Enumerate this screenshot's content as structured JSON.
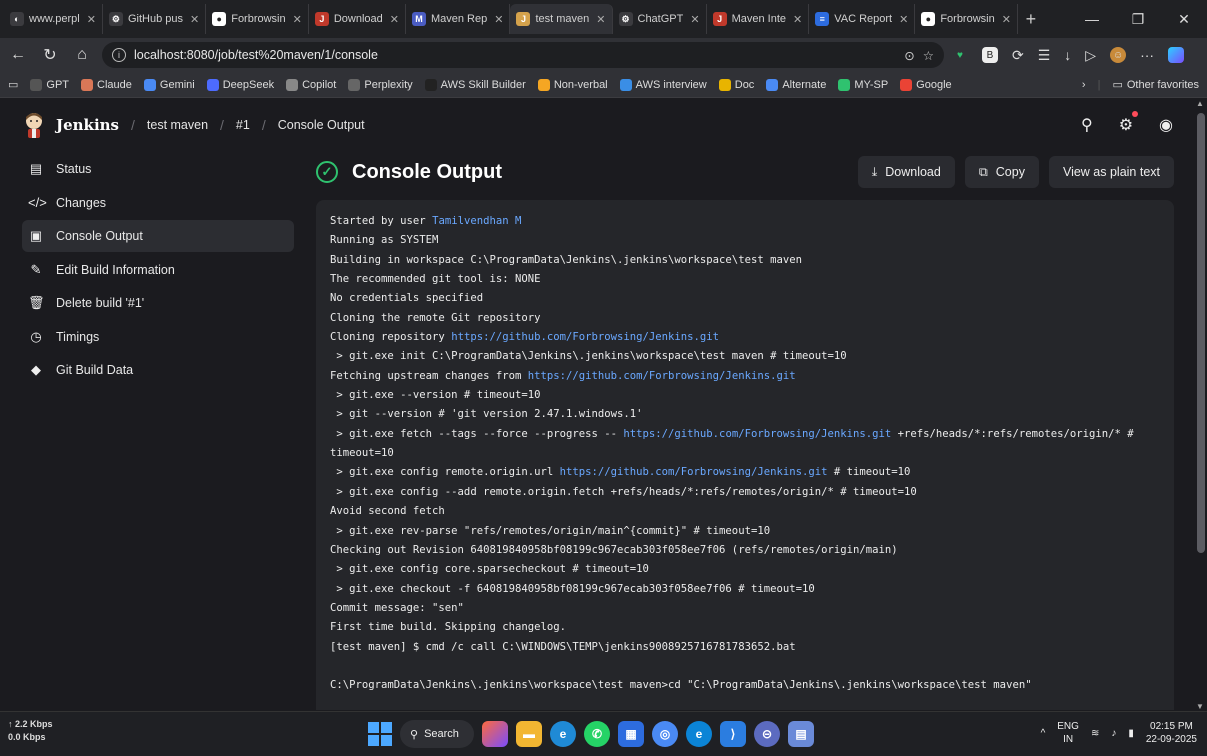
{
  "browser": {
    "tabs": [
      {
        "label": "www.perpl",
        "color": "#3b3b3f",
        "glyph": "◐"
      },
      {
        "label": "GitHub pus",
        "color": "#3b3b3f",
        "glyph": "⚙"
      },
      {
        "label": "Forbrowsin",
        "color": "#ffffff",
        "glyph": "●"
      },
      {
        "label": "Download",
        "color": "#c0392b",
        "glyph": "J"
      },
      {
        "label": "Maven Rep",
        "color": "#4a5cc2",
        "glyph": "M"
      },
      {
        "label": "test maven",
        "color": "#d4a24c",
        "glyph": "J",
        "active": true
      },
      {
        "label": "ChatGPT",
        "color": "#3b3b3f",
        "glyph": "⚙"
      },
      {
        "label": "Maven Inte",
        "color": "#c0392b",
        "glyph": "J"
      },
      {
        "label": "VAC Report",
        "color": "#2d6cdf",
        "glyph": "≡"
      },
      {
        "label": "Forbrowsin",
        "color": "#ffffff",
        "glyph": "●"
      }
    ],
    "new_tab": "+",
    "url": "localhost:8080/job/test%20maven/1/console",
    "favorites": [
      {
        "label": "GPT",
        "color": "#555"
      },
      {
        "label": "Claude",
        "color": "#d97757"
      },
      {
        "label": "Gemini",
        "color": "#4a8af4"
      },
      {
        "label": "DeepSeek",
        "color": "#4d6bfe"
      },
      {
        "label": "Copilot",
        "color": "#888"
      },
      {
        "label": "Perplexity",
        "color": "#666"
      },
      {
        "label": "AWS Skill Builder",
        "color": "#222"
      },
      {
        "label": "Non-verbal",
        "color": "#f5a623"
      },
      {
        "label": "AWS interview",
        "color": "#3a8ee6"
      },
      {
        "label": "Doc",
        "color": "#e8b400"
      },
      {
        "label": "Alternate",
        "color": "#4a8af4"
      },
      {
        "label": "MY-SP",
        "color": "#2fc26f"
      },
      {
        "label": "Google",
        "color": "#ea4335"
      }
    ],
    "other_favorites": "Other favorites"
  },
  "jenkins": {
    "brand": "Jenkins",
    "breadcrumbs": [
      "test maven",
      "#1",
      "Console Output"
    ],
    "sidebar": [
      {
        "label": "Status",
        "icon": "▤"
      },
      {
        "label": "Changes",
        "icon": "</>"
      },
      {
        "label": "Console Output",
        "icon": "▣",
        "active": true
      },
      {
        "label": "Edit Build Information",
        "icon": "✎"
      },
      {
        "label": "Delete build '#1'",
        "icon": "🗑"
      },
      {
        "label": "Timings",
        "icon": "◷"
      },
      {
        "label": "Git Build Data",
        "icon": "◆"
      }
    ],
    "page_title": "Console Output",
    "buttons": {
      "download": "Download",
      "copy": "Copy",
      "plain": "View as plain text"
    },
    "console_lines": [
      {
        "t": "Started by user ",
        "link": "Tamilvendhan M",
        "after": ""
      },
      {
        "t": "Running as SYSTEM"
      },
      {
        "t": "Building in workspace C:\\ProgramData\\Jenkins\\.jenkins\\workspace\\test maven"
      },
      {
        "t": "The recommended git tool is: NONE"
      },
      {
        "t": "No credentials specified"
      },
      {
        "t": "Cloning the remote Git repository"
      },
      {
        "t": "Cloning repository ",
        "link": "https://github.com/Forbrowsing/Jenkins.git",
        "after": ""
      },
      {
        "t": " > git.exe init C:\\ProgramData\\Jenkins\\.jenkins\\workspace\\test maven # timeout=10"
      },
      {
        "t": "Fetching upstream changes from ",
        "link": "https://github.com/Forbrowsing/Jenkins.git",
        "after": ""
      },
      {
        "t": " > git.exe --version # timeout=10"
      },
      {
        "t": " > git --version # 'git version 2.47.1.windows.1'"
      },
      {
        "t": " > git.exe fetch --tags --force --progress -- ",
        "link": "https://github.com/Forbrowsing/Jenkins.git",
        "after": " +refs/heads/*:refs/remotes/origin/* #"
      },
      {
        "t": "timeout=10"
      },
      {
        "t": " > git.exe config remote.origin.url ",
        "link": "https://github.com/Forbrowsing/Jenkins.git",
        "after": " # timeout=10"
      },
      {
        "t": " > git.exe config --add remote.origin.fetch +refs/heads/*:refs/remotes/origin/* # timeout=10"
      },
      {
        "t": "Avoid second fetch"
      },
      {
        "t": " > git.exe rev-parse \"refs/remotes/origin/main^{commit}\" # timeout=10"
      },
      {
        "t": "Checking out Revision 640819840958bf08199c967ecab303f058ee7f06 (refs/remotes/origin/main)"
      },
      {
        "t": " > git.exe config core.sparsecheckout # timeout=10"
      },
      {
        "t": " > git.exe checkout -f 640819840958bf08199c967ecab303f058ee7f06 # timeout=10"
      },
      {
        "t": "Commit message: \"sen\""
      },
      {
        "t": "First time build. Skipping changelog."
      },
      {
        "t": "[test maven] $ cmd /c call C:\\WINDOWS\\TEMP\\jenkins9008925716781783652.bat"
      },
      {
        "t": ""
      },
      {
        "t": "C:\\ProgramData\\Jenkins\\.jenkins\\workspace\\test maven>cd \"C:\\ProgramData\\Jenkins\\.jenkins\\workspace\\test maven\""
      }
    ]
  },
  "taskbar": {
    "net_up": "↑ 2.2 Kbps",
    "net_down": "0.0 Kbps",
    "search": "Search",
    "lang_top": "ENG",
    "lang_bottom": "IN",
    "time": "02:15 PM",
    "date": "22-09-2025"
  }
}
